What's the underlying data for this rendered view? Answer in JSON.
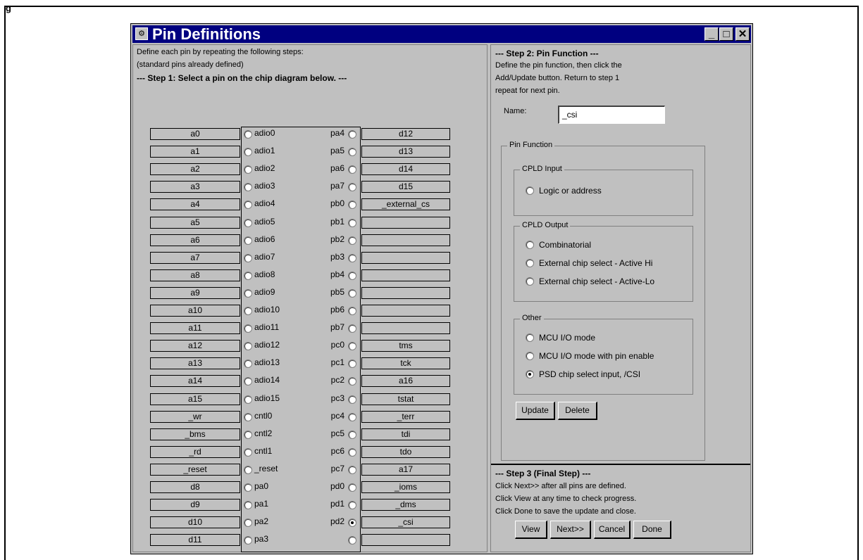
{
  "figure_label": "g",
  "window": {
    "title": "Pin Definitions",
    "controls": {
      "minimize": "_",
      "maximize": "□",
      "close": "✕"
    }
  },
  "step1": {
    "intro_line1": "Define each pin by repeating the following steps:",
    "intro_line2": "(standard pins already defined)",
    "heading": "--- Step 1: Select a pin on the chip diagram below. ---"
  },
  "pins": [
    {
      "left_box": "a0",
      "left_pin": "adio0",
      "left_selected": false,
      "right_pin": "pa4",
      "right_selected": false,
      "right_box": "d12"
    },
    {
      "left_box": "a1",
      "left_pin": "adio1",
      "left_selected": false,
      "right_pin": "pa5",
      "right_selected": false,
      "right_box": "d13"
    },
    {
      "left_box": "a2",
      "left_pin": "adio2",
      "left_selected": false,
      "right_pin": "pa6",
      "right_selected": false,
      "right_box": "d14"
    },
    {
      "left_box": "a3",
      "left_pin": "adio3",
      "left_selected": false,
      "right_pin": "pa7",
      "right_selected": false,
      "right_box": "d15"
    },
    {
      "left_box": "a4",
      "left_pin": "adio4",
      "left_selected": false,
      "right_pin": "pb0",
      "right_selected": false,
      "right_box": "_external_cs"
    },
    {
      "left_box": "a5",
      "left_pin": "adio5",
      "left_selected": false,
      "right_pin": "pb1",
      "right_selected": false,
      "right_box": ""
    },
    {
      "left_box": "a6",
      "left_pin": "adio6",
      "left_selected": false,
      "right_pin": "pb2",
      "right_selected": false,
      "right_box": ""
    },
    {
      "left_box": "a7",
      "left_pin": "adio7",
      "left_selected": false,
      "right_pin": "pb3",
      "right_selected": false,
      "right_box": ""
    },
    {
      "left_box": "a8",
      "left_pin": "adio8",
      "left_selected": false,
      "right_pin": "pb4",
      "right_selected": false,
      "right_box": ""
    },
    {
      "left_box": "a9",
      "left_pin": "adio9",
      "left_selected": false,
      "right_pin": "pb5",
      "right_selected": false,
      "right_box": ""
    },
    {
      "left_box": "a10",
      "left_pin": "adio10",
      "left_selected": false,
      "right_pin": "pb6",
      "right_selected": false,
      "right_box": ""
    },
    {
      "left_box": "a11",
      "left_pin": "adio11",
      "left_selected": false,
      "right_pin": "pb7",
      "right_selected": false,
      "right_box": ""
    },
    {
      "left_box": "a12",
      "left_pin": "adio12",
      "left_selected": false,
      "right_pin": "pc0",
      "right_selected": false,
      "right_box": "tms"
    },
    {
      "left_box": "a13",
      "left_pin": "adio13",
      "left_selected": false,
      "right_pin": "pc1",
      "right_selected": false,
      "right_box": "tck"
    },
    {
      "left_box": "a14",
      "left_pin": "adio14",
      "left_selected": false,
      "right_pin": "pc2",
      "right_selected": false,
      "right_box": "a16"
    },
    {
      "left_box": "a15",
      "left_pin": "adio15",
      "left_selected": false,
      "right_pin": "pc3",
      "right_selected": false,
      "right_box": "tstat"
    },
    {
      "left_box": "_wr",
      "left_pin": "cntl0",
      "left_selected": false,
      "right_pin": "pc4",
      "right_selected": false,
      "right_box": "_terr"
    },
    {
      "left_box": "_bms",
      "left_pin": "cntl2",
      "left_selected": false,
      "right_pin": "pc5",
      "right_selected": false,
      "right_box": "tdi"
    },
    {
      "left_box": "_rd",
      "left_pin": "cntl1",
      "left_selected": false,
      "right_pin": "pc6",
      "right_selected": false,
      "right_box": "tdo"
    },
    {
      "left_box": "_reset",
      "left_pin": "_reset",
      "left_selected": false,
      "right_pin": "pc7",
      "right_selected": false,
      "right_box": "a17"
    },
    {
      "left_box": "d8",
      "left_pin": "pa0",
      "left_selected": false,
      "right_pin": "pd0",
      "right_selected": false,
      "right_box": "_ioms"
    },
    {
      "left_box": "d9",
      "left_pin": "pa1",
      "left_selected": false,
      "right_pin": "pd1",
      "right_selected": false,
      "right_box": "_dms"
    },
    {
      "left_box": "d10",
      "left_pin": "pa2",
      "left_selected": false,
      "right_pin": "pd2",
      "right_selected": true,
      "right_box": "_csi"
    },
    {
      "left_box": "d11",
      "left_pin": "pa3",
      "left_selected": false,
      "right_pin": "",
      "right_selected": false,
      "right_box": ""
    }
  ],
  "step2": {
    "heading": "--- Step 2: Pin Function ---",
    "line1": "Define the pin function, then click the",
    "line2": "Add/Update button.  Return to step 1",
    "line3": "repeat for next pin.",
    "name_label": "Name:",
    "name_value": "_csi",
    "pin_function_title": "Pin Function",
    "cpld_input": {
      "title": "CPLD Input",
      "options": [
        {
          "label": "Logic or address",
          "selected": false
        }
      ]
    },
    "cpld_output": {
      "title": "CPLD Output",
      "options": [
        {
          "label": "Combinatorial",
          "selected": false
        },
        {
          "label": "External chip select - Active Hi",
          "selected": false
        },
        {
          "label": "External chip select - Active-Lo",
          "selected": false
        }
      ]
    },
    "other": {
      "title": "Other",
      "options": [
        {
          "label": "MCU I/O mode",
          "selected": false
        },
        {
          "label": "MCU I/O mode with pin enable",
          "selected": false
        },
        {
          "label": "PSD chip select input, /CSI",
          "selected": true
        }
      ]
    },
    "update_label": "Update",
    "delete_label": "Delete"
  },
  "step3": {
    "heading": "--- Step 3 (Final Step) ---",
    "line1": "Click Next>> after all pins are defined.",
    "line2": "Click View at any time to check progress.",
    "line3": "Click Done to save the update and close.",
    "view_label": "View",
    "next_label": "Next>>",
    "cancel_label": "Cancel",
    "done_label": "Done"
  }
}
